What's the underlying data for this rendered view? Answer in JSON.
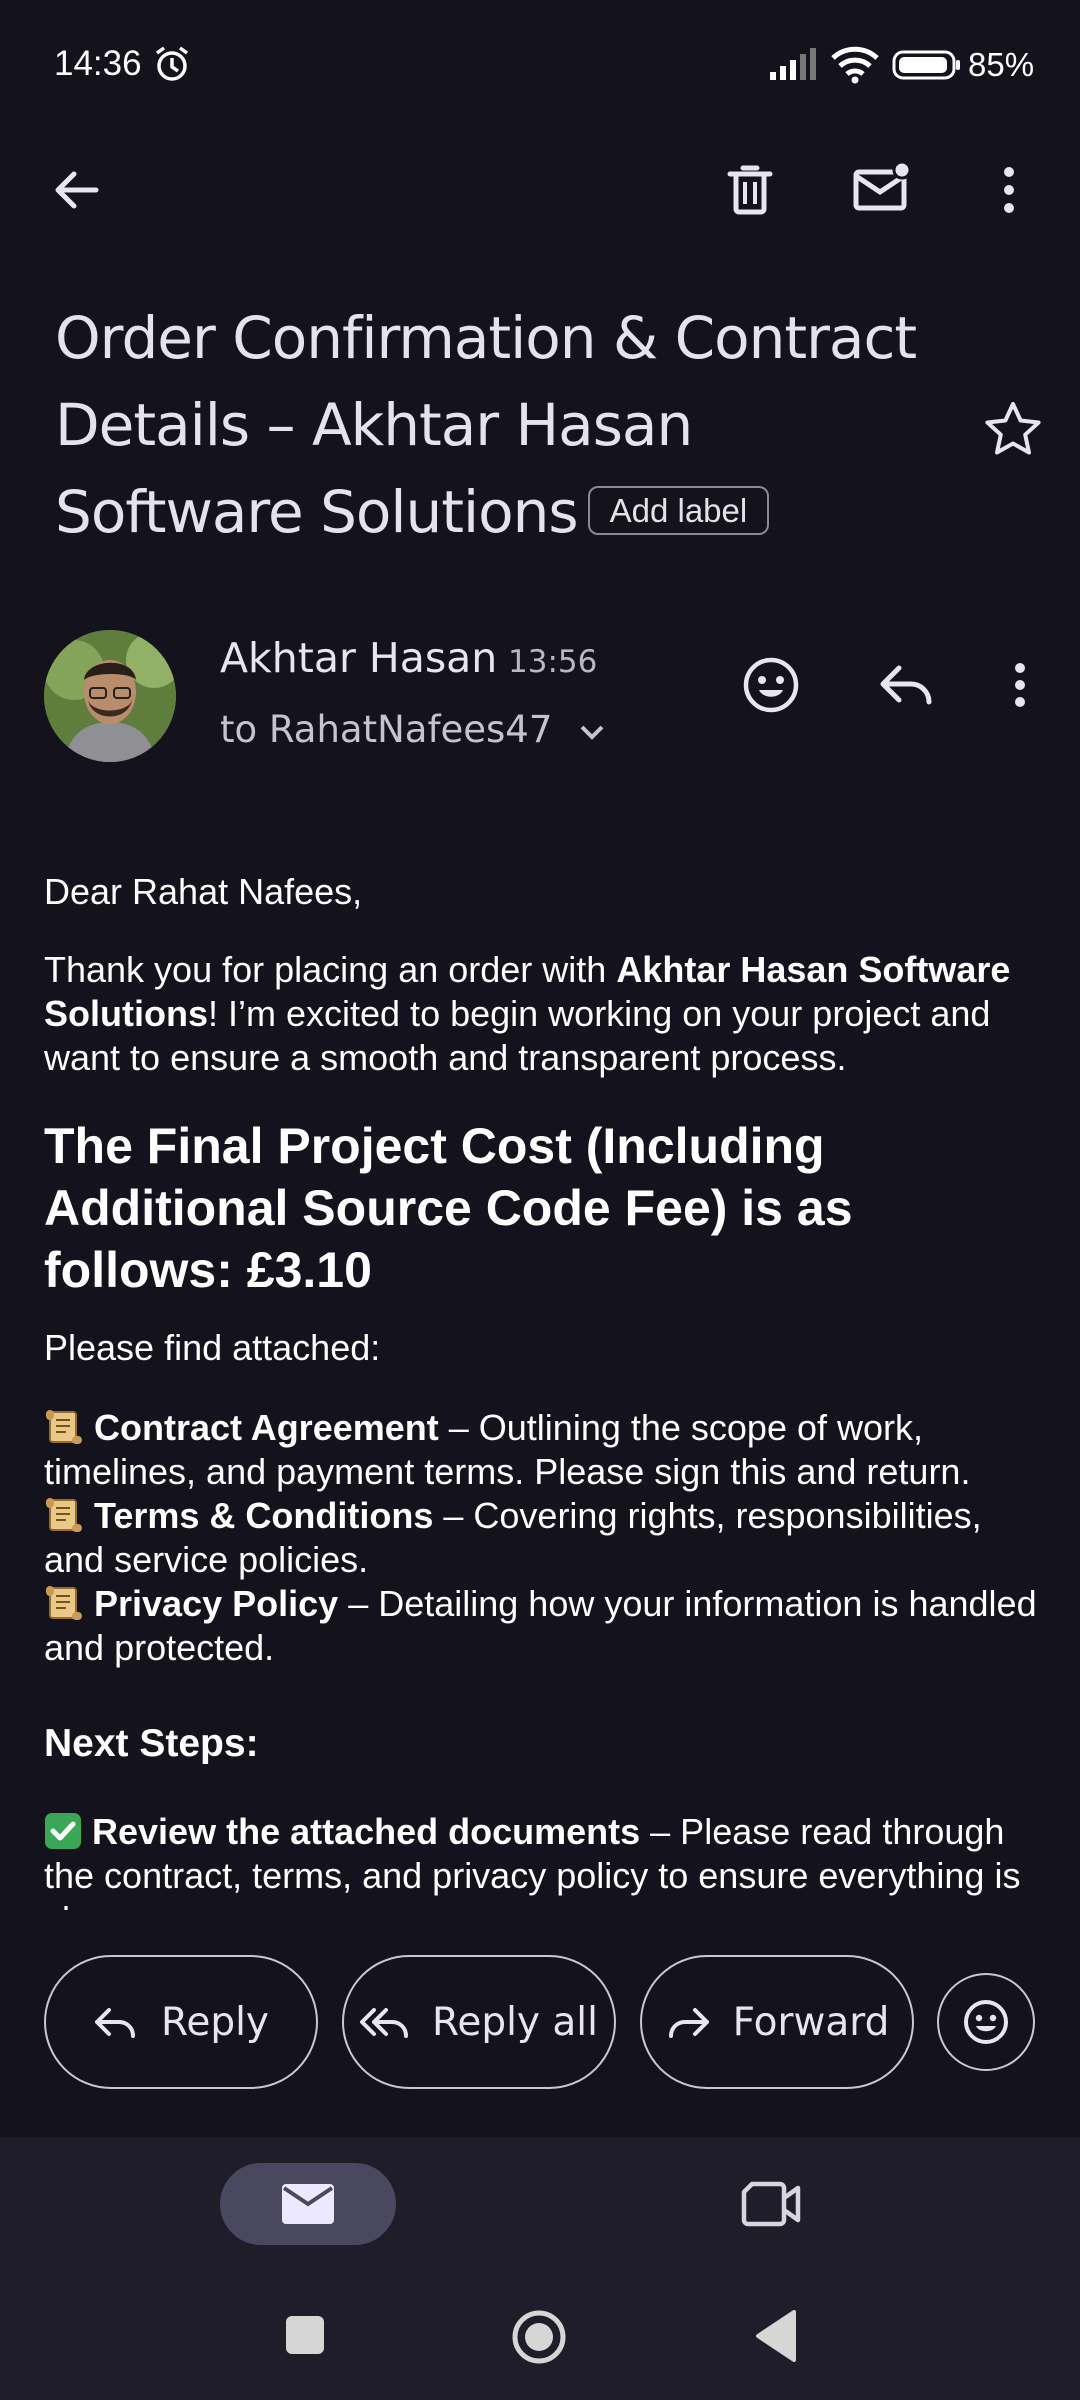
{
  "status_bar": {
    "time": "14:36",
    "battery": "85%"
  },
  "subject": {
    "text": "Order Confirmation & Contract Details – Akhtar Hasan Software Solutions",
    "add_label": "Add label"
  },
  "sender": {
    "name": "Akhtar Hasan",
    "time": "13:56",
    "recipient": "to RahatNafees47"
  },
  "body": {
    "greeting": "Dear Rahat Nafees,",
    "intro_pre": "Thank you for placing an order with ",
    "intro_bold": "Akhtar Hasan Software Solutions",
    "intro_post": "! I’m excited to begin working on your project and want to ensure a smooth and transparent process.",
    "cost_heading": "The Final Project Cost (Including Additional Source Code Fee) is as follows: £3.10",
    "attached_intro": "Please find attached:",
    "attachments": [
      {
        "title": "Contract Agreement",
        "desc": " – Outlining the scope of work, timelines, and payment terms. Please sign this and return."
      },
      {
        "title": "Terms & Conditions",
        "desc": " – Covering rights, responsibilities, and service policies."
      },
      {
        "title": "Privacy Policy",
        "desc": " – Detailing how your information is handled and protected."
      }
    ],
    "next_steps_heading": "Next Steps:",
    "step1_title": "Review the attached documents",
    "step1_desc": " – Please read through the contract, terms, and privacy policy to ensure everything is clear."
  },
  "actions": {
    "reply": "Reply",
    "reply_all": "Reply all",
    "forward": "Forward"
  },
  "icons": [
    "back-arrow-icon",
    "delete-icon",
    "mark-unread-icon",
    "more-icon",
    "star-icon",
    "emoji-icon",
    "reply-icon",
    "mail-icon",
    "video-icon"
  ]
}
